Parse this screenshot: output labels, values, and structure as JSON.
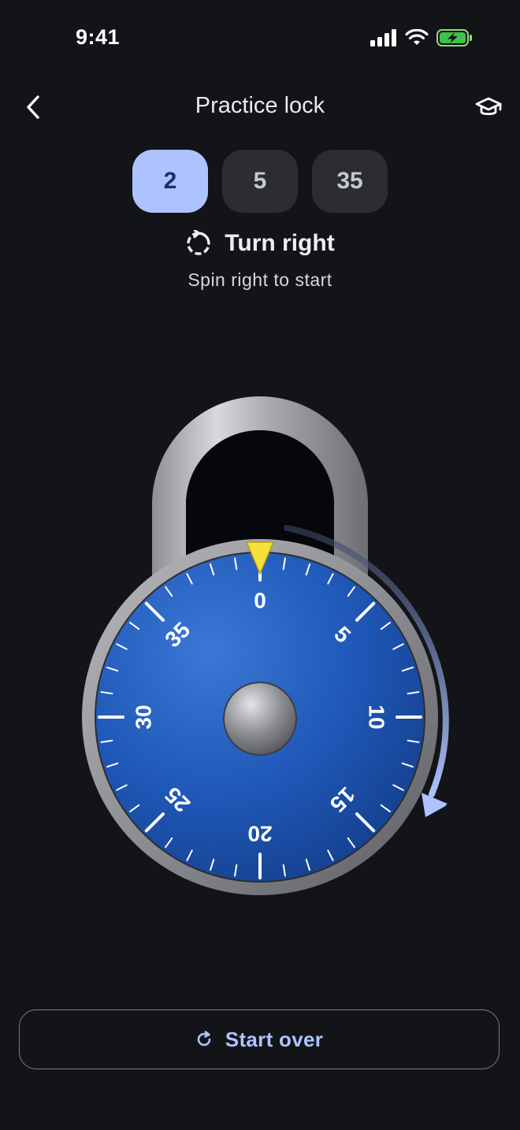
{
  "status_bar": {
    "time": "9:41",
    "icons": [
      "cellular-signal-icon",
      "wifi-icon",
      "battery-charging-icon"
    ]
  },
  "nav": {
    "title": "Practice lock",
    "back_icon": "chevron-left-icon",
    "learn_icon": "graduation-cap-icon"
  },
  "combination": {
    "numbers": [
      "2",
      "5",
      "35"
    ],
    "active_index": 0
  },
  "instruction": {
    "icon": "rotate-clockwise-icon",
    "title": "Turn right",
    "subtitle": "Spin right to start"
  },
  "dial": {
    "labels": [
      "0",
      "5",
      "10",
      "15",
      "20",
      "25",
      "30",
      "35"
    ],
    "max_value": 40,
    "current_value": 0,
    "pointer_icon": "yellow-triangle-pointer",
    "direction_arrow": "clockwise-arrow-icon"
  },
  "footer": {
    "start_over_label": "Start over",
    "start_over_icon": "refresh-icon"
  },
  "colors": {
    "background": "#131418",
    "accent": "#adc3ff",
    "dial_blue": "#1f58b8",
    "pointer_yellow": "#f6e03a",
    "pill_inactive": "#2b2d33"
  }
}
